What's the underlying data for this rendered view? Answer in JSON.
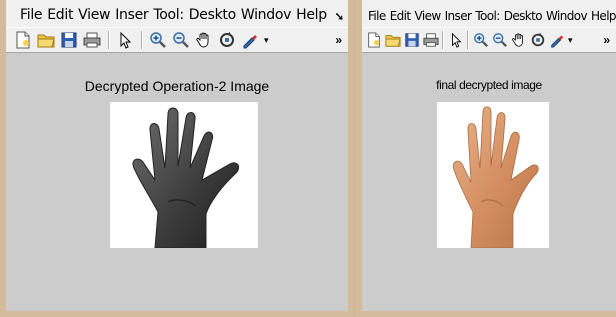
{
  "menu_left": [
    "File",
    "Edit",
    "View",
    "Inser",
    "Tool:",
    "Deskto",
    "Windov",
    "Help"
  ],
  "menu_right": [
    "File",
    "Edit",
    "View",
    "Inser",
    "Tool:",
    "Deskto",
    "Windov",
    "Help"
  ],
  "menu_overflow": "➘",
  "toolbar_overflow": "»",
  "left_figure": {
    "title": "Decrypted Operation-2 Image"
  },
  "right_figure": {
    "title": "final decrypted image"
  },
  "colors": {
    "window_border": "#d4bb9b",
    "figure_bg": "#cccccc",
    "toolbar_bg": "#f0f0f0",
    "hand_gray": "#3c3c3c",
    "hand_skin": "#d9976c"
  },
  "icons": [
    "new-file-icon",
    "open-folder-icon",
    "save-icon",
    "print-icon",
    "pointer-icon",
    "zoom-in-icon",
    "zoom-out-icon",
    "pan-hand-icon",
    "rotate-3d-icon",
    "data-cursor-icon"
  ]
}
